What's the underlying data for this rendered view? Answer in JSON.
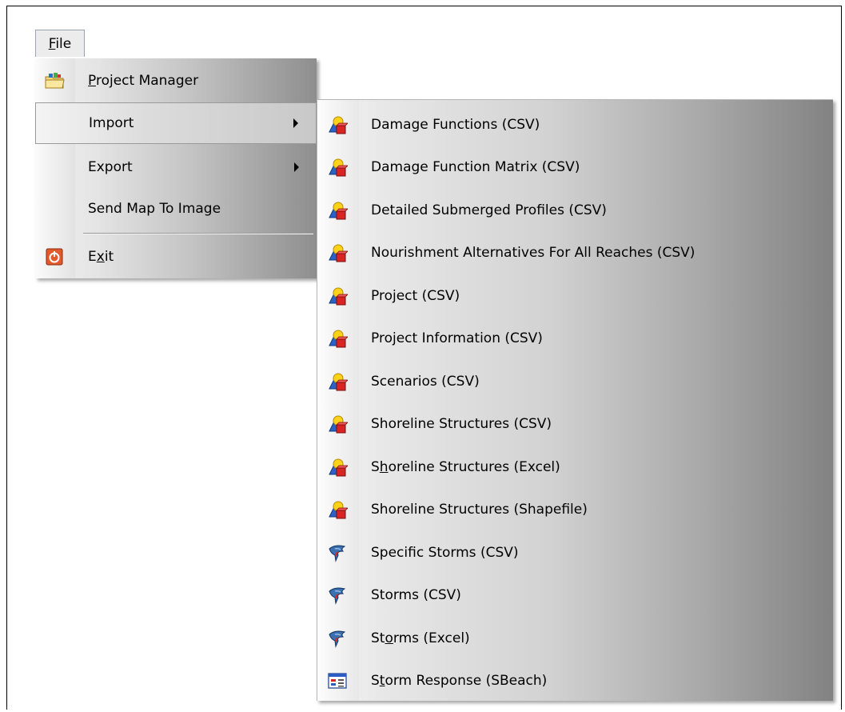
{
  "menubar": {
    "file": {
      "label_prefix": "",
      "accel": "F",
      "label_rest": "ile"
    }
  },
  "file_menu": {
    "items": [
      {
        "accel": "P",
        "rest": "roject Manager",
        "icon": "folder-open-icon"
      },
      {
        "label": "Import",
        "submenu": true
      },
      {
        "label": "Export",
        "submenu": true
      },
      {
        "label": "Send Map To  Image"
      },
      {
        "pre": "E",
        "accel": "x",
        "rest": "it",
        "icon": "exit-power-icon"
      }
    ]
  },
  "import_submenu": {
    "items": [
      {
        "label": "Damage Functions (CSV)",
        "icon": "shapes-icon"
      },
      {
        "label": "Damage Function Matrix (CSV)",
        "icon": "shapes-icon"
      },
      {
        "label": "Detailed Submerged Profiles (CSV)",
        "icon": "shapes-icon"
      },
      {
        "label": "Nourishment Alternatives For All Reaches (CSV)",
        "icon": "shapes-icon"
      },
      {
        "label": "Project (CSV)",
        "icon": "shapes-icon"
      },
      {
        "label": "Project Information (CSV)",
        "icon": "shapes-icon"
      },
      {
        "label": "Scenarios (CSV)",
        "icon": "shapes-icon"
      },
      {
        "label": "Shoreline Structures (CSV)",
        "icon": "shapes-icon"
      },
      {
        "pre": "S",
        "accel": "h",
        "rest": "oreline Structures (Excel)",
        "icon": "shapes-icon"
      },
      {
        "label": "Shoreline Structures (Shapefile)",
        "icon": "shapes-icon"
      },
      {
        "label": "Specific Storms (CSV)",
        "icon": "storm-icon"
      },
      {
        "label": "Storms (CSV)",
        "icon": "storm-icon"
      },
      {
        "pre": "St",
        "accel": "o",
        "rest": "rms (Excel)",
        "icon": "storm-icon"
      },
      {
        "pre": "S",
        "accel": "t",
        "rest": "orm Response (SBeach)",
        "icon": "window-grid-icon"
      }
    ]
  }
}
